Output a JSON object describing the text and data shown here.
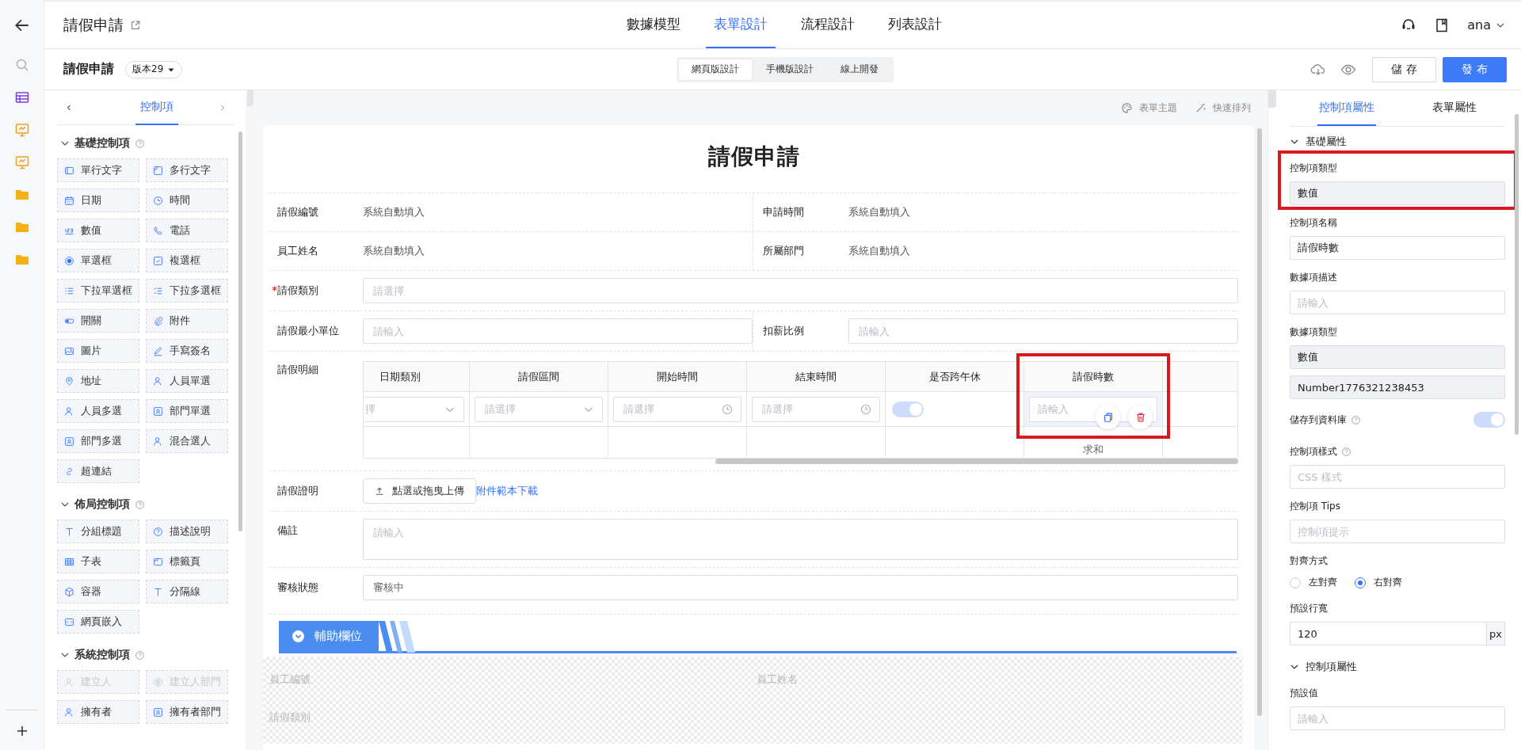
{
  "rail": {
    "items": [
      {
        "kind": "search"
      },
      {
        "kind": "table"
      },
      {
        "kind": "board"
      },
      {
        "kind": "board"
      },
      {
        "kind": "folder"
      },
      {
        "kind": "folder"
      },
      {
        "kind": "folder"
      }
    ]
  },
  "app_bar": {
    "title": "請假申請",
    "nav_tabs": [
      {
        "label": "數據模型",
        "selected": false
      },
      {
        "label": "表單設計",
        "selected": true
      },
      {
        "label": "流程設計",
        "selected": false
      },
      {
        "label": "列表設計",
        "selected": false
      }
    ],
    "user": "ana"
  },
  "toolbar": {
    "form_name": "請假申請",
    "version": "版本29",
    "modes": [
      {
        "label": "網頁版設計",
        "selected": true
      },
      {
        "label": "手機版設計",
        "selected": false
      },
      {
        "label": "線上開發",
        "selected": false
      }
    ],
    "buttons": [
      {
        "label": "儲 存",
        "kind": "secondary"
      },
      {
        "label": "發 布",
        "kind": "primary"
      }
    ]
  },
  "palette": {
    "tabs": [
      {
        "label": "控制項",
        "selected": true
      }
    ],
    "groups": [
      {
        "title": "基礎控制項",
        "expanded": true,
        "items": [
          {
            "label": "單行文字",
            "disabled": false
          },
          {
            "label": "多行文字",
            "disabled": false
          },
          {
            "label": "日期",
            "disabled": false
          },
          {
            "label": "時間",
            "disabled": false
          },
          {
            "label": "數值",
            "disabled": false
          },
          {
            "label": "電話",
            "disabled": false
          },
          {
            "label": "單選框",
            "disabled": false
          },
          {
            "label": "複選框",
            "disabled": false
          },
          {
            "label": "下拉單選框",
            "disabled": false
          },
          {
            "label": "下拉多選框",
            "disabled": false
          },
          {
            "label": "開關",
            "disabled": false
          },
          {
            "label": "附件",
            "disabled": false
          },
          {
            "label": "圖片",
            "disabled": false
          },
          {
            "label": "手寫簽名",
            "disabled": false
          },
          {
            "label": "地址",
            "disabled": false
          },
          {
            "label": "人員單選",
            "disabled": false
          },
          {
            "label": "人員多選",
            "disabled": false
          },
          {
            "label": "部門單選",
            "disabled": false
          },
          {
            "label": "部門多選",
            "disabled": false
          },
          {
            "label": "混合選人",
            "disabled": false
          },
          {
            "label": "超連結",
            "disabled": false
          }
        ]
      },
      {
        "title": "佈局控制項",
        "expanded": true,
        "items": [
          {
            "label": "分組標題",
            "disabled": false
          },
          {
            "label": "描述說明",
            "disabled": false
          },
          {
            "label": "子表",
            "disabled": false
          },
          {
            "label": "標籤頁",
            "disabled": false
          },
          {
            "label": "容器",
            "disabled": false
          },
          {
            "label": "分隔線",
            "disabled": false
          },
          {
            "label": "網頁嵌入",
            "disabled": false
          }
        ]
      },
      {
        "title": "系統控制項",
        "expanded": true,
        "items": [
          {
            "label": "建立人",
            "disabled": true
          },
          {
            "label": "建立人部門",
            "disabled": true
          },
          {
            "label": "擁有者",
            "disabled": false
          },
          {
            "label": "擁有者部門",
            "disabled": false
          }
        ]
      }
    ]
  },
  "canvas_tools": [
    {
      "label": "表單主題"
    },
    {
      "label": "快速排列"
    }
  ],
  "form": {
    "title": "請假申請",
    "rows": [
      {
        "kind": "pair",
        "fields": [
          {
            "label": "請假編號",
            "value": "系統自動填入"
          },
          {
            "label": "申請時間",
            "value": "系統自動填入"
          }
        ]
      },
      {
        "kind": "pair",
        "fields": [
          {
            "label": "員工姓名",
            "value": "系統自動填入"
          },
          {
            "label": "所屬部門",
            "value": "系統自動填入"
          }
        ]
      },
      {
        "kind": "input",
        "label": "請假類別",
        "required": true,
        "placeholder": "請選擇"
      },
      {
        "kind": "inputs",
        "fields": [
          {
            "label": "請假最小單位",
            "placeholder": "請輸入"
          },
          {
            "label": "扣薪比例",
            "placeholder": "請輸入"
          }
        ]
      },
      {
        "kind": "subtable",
        "label": "請假明細",
        "required": false,
        "columns": [
          {
            "label": "日期類別",
            "cell": {
              "kind": "select",
              "placeholder": "擇"
            },
            "highlighted": false
          },
          {
            "label": "請假區間",
            "cell": {
              "kind": "select",
              "placeholder": "請選擇"
            },
            "highlighted": false
          },
          {
            "label": "開始時間",
            "cell": {
              "kind": "time",
              "placeholder": "請選擇"
            },
            "highlighted": false
          },
          {
            "label": "結束時間",
            "cell": {
              "kind": "time",
              "placeholder": "請選擇"
            },
            "highlighted": false
          },
          {
            "label": "是否跨午休",
            "cell": {
              "kind": "switch",
              "on": true
            },
            "highlighted": false
          },
          {
            "label": "請假時數",
            "cell": {
              "kind": "number",
              "placeholder": "請輸入"
            },
            "footer": "求和",
            "highlighted": true
          }
        ]
      },
      {
        "kind": "upload",
        "label": "請假證明",
        "required": false,
        "button": "點選或拖曳上傳",
        "link": "附件範本下載"
      },
      {
        "kind": "textarea",
        "label": "備註",
        "required": false,
        "placeholder": "請輸入"
      },
      {
        "kind": "input",
        "label": "審核狀態",
        "required": false,
        "value": "審核中"
      }
    ],
    "aux_section": {
      "title": "輔助欄位",
      "expanded": true,
      "fields": [
        {
          "label": "員工編號"
        },
        {
          "label": "員工姓名"
        },
        {
          "label": "請假類別"
        }
      ]
    }
  },
  "properties": {
    "tabs": [
      {
        "label": "控制項屬性",
        "selected": true
      },
      {
        "label": "表單屬性",
        "selected": false
      }
    ],
    "sections": [
      {
        "title": "基礎屬性",
        "expanded": true,
        "items": [
          {
            "kind": "readonly",
            "label": "控制項類型",
            "values": [
              "數值"
            ],
            "help": false,
            "highlighted": true
          },
          {
            "kind": "input",
            "label": "控制項名稱",
            "value": "請假時數",
            "help": false,
            "highlighted": false
          },
          {
            "kind": "input",
            "label": "數據項描述",
            "placeholder": "請輸入",
            "help": false,
            "highlighted": false
          },
          {
            "kind": "readonly",
            "label": "數據項類型",
            "values": [
              "數值",
              "Number1776321238453"
            ],
            "help": false,
            "highlighted": false
          },
          {
            "kind": "switch",
            "label": "儲存到資料庫",
            "on": true,
            "help": true,
            "highlighted": false
          },
          {
            "kind": "input",
            "label": "控制項樣式",
            "placeholder": "CSS 樣式",
            "help": true,
            "highlighted": false
          },
          {
            "kind": "input",
            "label": "控制項 Tips",
            "placeholder": "控制項提示",
            "help": false,
            "highlighted": false
          },
          {
            "kind": "radio",
            "label": "對齊方式",
            "options": [
              {
                "label": "左對齊",
                "selected": false
              },
              {
                "label": "右對齊",
                "selected": true
              }
            ],
            "help": false,
            "highlighted": false
          },
          {
            "kind": "unit",
            "label": "預設行寬",
            "value": "120",
            "unit": "px",
            "help": false,
            "highlighted": false
          }
        ]
      },
      {
        "title": "控制項屬性",
        "expanded": true,
        "items": [
          {
            "kind": "input",
            "label": "預設值",
            "placeholder": "請輸入",
            "help": false,
            "highlighted": false
          }
        ]
      }
    ]
  }
}
